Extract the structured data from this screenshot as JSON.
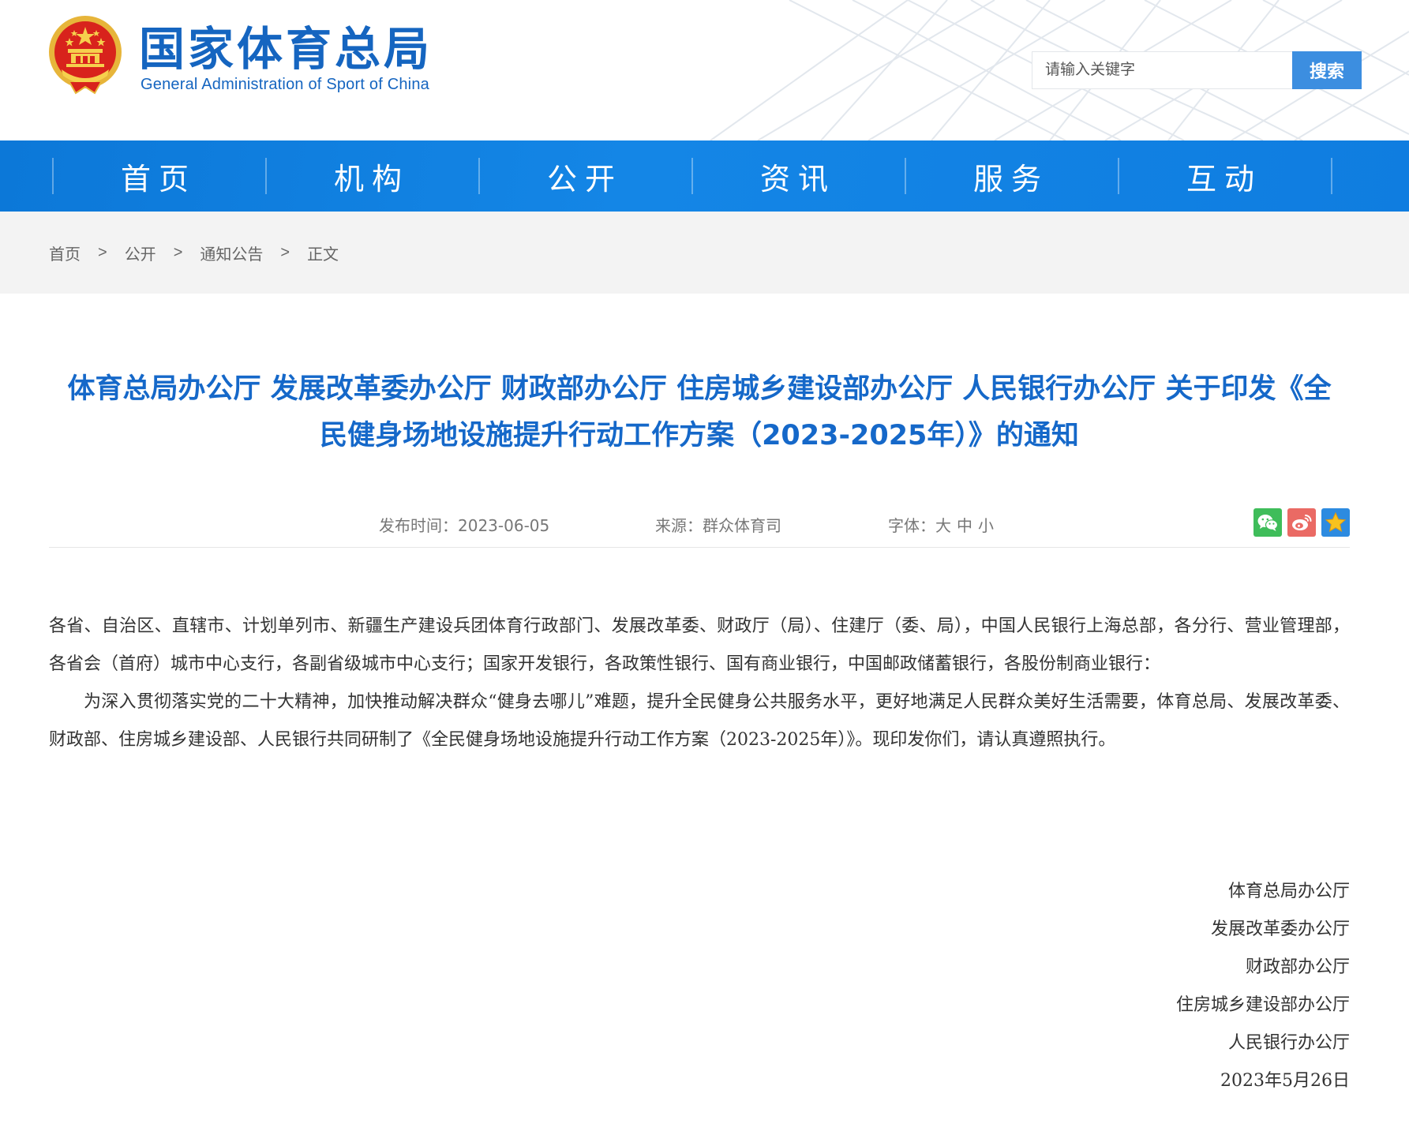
{
  "header": {
    "site_title": "国家体育总局",
    "site_subtitle": "General Administration of Sport of China",
    "search_placeholder": "请输入关键字",
    "search_button": "搜索"
  },
  "nav": {
    "items": [
      {
        "label": "首页"
      },
      {
        "label": "机构"
      },
      {
        "label": "公开"
      },
      {
        "label": "资讯"
      },
      {
        "label": "服务"
      },
      {
        "label": "互动"
      }
    ]
  },
  "breadcrumb": {
    "items": [
      "首页",
      "公开",
      "通知公告",
      "正文"
    ],
    "separator": ">"
  },
  "article": {
    "title_line1": "体育总局办公厅 发展改革委办公厅 财政部办公厅 住房城乡建设部办公厅 人民银行办公厅 关于印发《全",
    "title_line2": "民健身场地设施提升行动工作方案（2023-2025年）》的通知",
    "meta": {
      "publish_time": "发布时间：2023-06-05",
      "source": "来源：群众体育司",
      "font_label": "字体：",
      "font_sizes": [
        "大",
        "中",
        "小"
      ]
    },
    "paragraphs": [
      "各省、自治区、直辖市、计划单列市、新疆生产建设兵团体育行政部门、发展改革委、财政厅（局）、住建厅（委、局），中国人民银行上海总部，各分行、营业管理部，各省会（首府）城市中心支行，各副省级城市中心支行；国家开发银行，各政策性银行、国有商业银行，中国邮政储蓄银行，各股份制商业银行：",
      "为深入贯彻落实党的二十大精神，加快推动解决群众“健身去哪儿”难题，提升全民健身公共服务水平，更好地满足人民群众美好生活需要，体育总局、发展改革委、财政部、住房城乡建设部、人民银行共同研制了《全民健身场地设施提升行动工作方案（2023-2025年）》。现印发你们，请认真遵照执行。"
    ],
    "signatures": [
      "体育总局办公厅",
      "发展改革委办公厅",
      "财政部办公厅",
      "住房城乡建设部办公厅",
      "人民银行办公厅",
      "2023年5月26日"
    ]
  },
  "colors": {
    "brand_blue": "#1565c0",
    "nav_blue": "#0f7de0",
    "title_blue": "#1568c9",
    "search_button": "#3c8ee0",
    "wechat_green": "#3fbd5a",
    "weibo_red": "#ea6a64",
    "favorite_blue": "#2d8be0"
  },
  "icons": {
    "logo": "national-emblem-icon",
    "share": [
      "wechat-icon",
      "weibo-icon",
      "favorite-star-icon"
    ]
  }
}
